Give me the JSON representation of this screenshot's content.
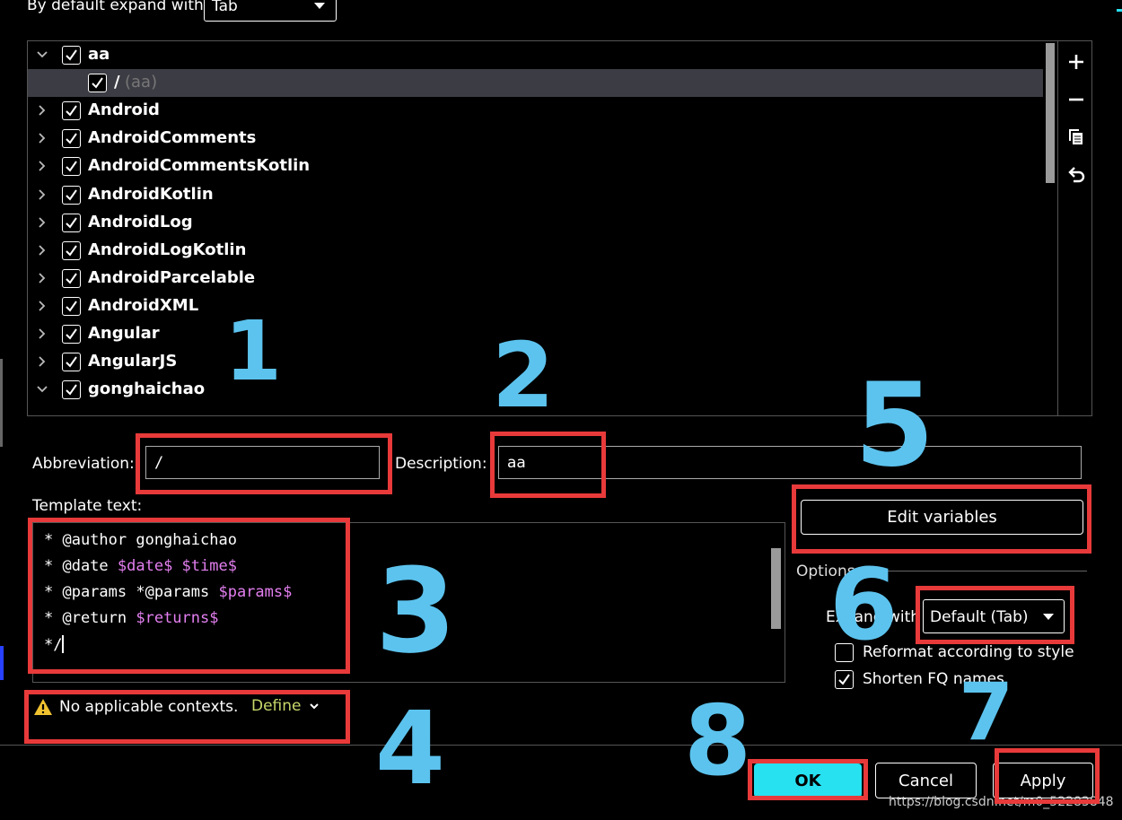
{
  "top": {
    "expand_label": "By default expand with",
    "expand_value": "Tab"
  },
  "tree": {
    "rows": [
      {
        "label": "aa",
        "expanded": true,
        "checked": true
      },
      {
        "label": "/",
        "suffix": "(aa)",
        "checked": true,
        "selected": true
      },
      {
        "label": "Android",
        "checked": true
      },
      {
        "label": "AndroidComments",
        "checked": true
      },
      {
        "label": "AndroidCommentsKotlin",
        "checked": true
      },
      {
        "label": "AndroidKotlin",
        "checked": true
      },
      {
        "label": "AndroidLog",
        "checked": true
      },
      {
        "label": "AndroidLogKotlin",
        "checked": true
      },
      {
        "label": "AndroidParcelable",
        "checked": true
      },
      {
        "label": "AndroidXML",
        "checked": true
      },
      {
        "label": "Angular",
        "checked": true
      },
      {
        "label": "AngularJS",
        "checked": true
      },
      {
        "label": "gonghaichao",
        "expanded": true,
        "checked": true
      }
    ],
    "toolbar_icons": [
      "plus-icon",
      "minus-icon",
      "copy-icon",
      "revert-icon"
    ]
  },
  "form": {
    "abbreviation_label": "Abbreviation:",
    "abbreviation_value": "/",
    "description_label": "Description:",
    "description_value": "aa",
    "template_label": "Template text:",
    "template_lines": [
      {
        "text": "* @author gonghaichao",
        "var": ""
      },
      {
        "text": "* @date ",
        "var": "$date$ $time$"
      },
      {
        "text": "* @params *@params ",
        "var": "$params$"
      },
      {
        "text": "* @return ",
        "var": "$returns$"
      },
      {
        "text": "*/",
        "var": ""
      }
    ]
  },
  "right_panel": {
    "edit_variables": "Edit variables",
    "options_label": "Options",
    "expand_with_label": "Expand with",
    "expand_with_value": "Default (Tab)",
    "reformat_label": "Reformat according to style",
    "reformat_checked": false,
    "shorten_label": "Shorten FQ names",
    "shorten_checked": true
  },
  "context": {
    "warning_text": "No applicable contexts.",
    "define_link": "Define"
  },
  "buttons": {
    "ok": "OK",
    "cancel": "Cancel",
    "apply": "Apply"
  },
  "watermark": "https://blog.csdn.net/m0_52283848",
  "annotations": [
    "1",
    "2",
    "3",
    "4",
    "5",
    "6",
    "7",
    "8"
  ],
  "colors": {
    "accent": "#27e0f0",
    "annotation_box": "#e83a3a",
    "annotation_digit": "#5cc3ee",
    "template_variable": "#e37ff0"
  }
}
